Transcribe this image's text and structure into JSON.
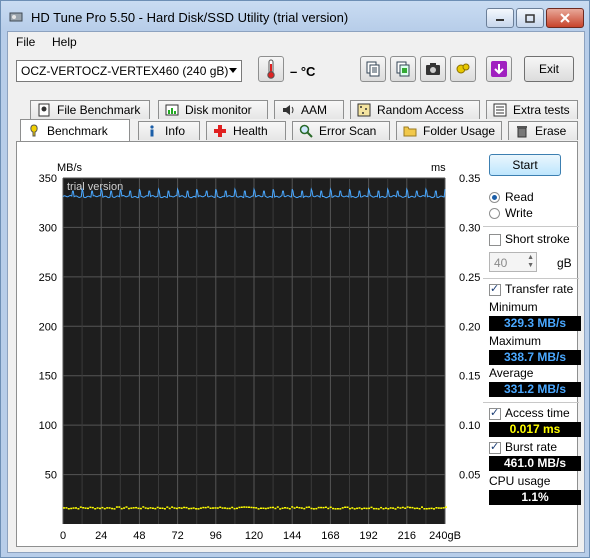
{
  "window": {
    "title": "HD Tune Pro 5.50 - Hard Disk/SSD Utility (trial version)"
  },
  "menu": {
    "file": "File",
    "help": "Help"
  },
  "toolbar": {
    "drive": "OCZ-VERTOCZ-VERTEX460 (240 gB)",
    "temperature": "– °C",
    "exit": "Exit"
  },
  "tabs_top": [
    "File Benchmark",
    "Disk monitor",
    "AAM",
    "Random Access",
    "Extra tests"
  ],
  "tabs_bottom": [
    "Benchmark",
    "Info",
    "Health",
    "Error Scan",
    "Folder Usage",
    "Erase"
  ],
  "controls": {
    "start": "Start",
    "read": "Read",
    "write": "Write",
    "short_stroke": "Short stroke",
    "stroke_value": "40",
    "stroke_unit": "gB",
    "transfer_rate": "Transfer rate",
    "minimum_label": "Minimum",
    "minimum_value": "329.3 MB/s",
    "maximum_label": "Maximum",
    "maximum_value": "338.7 MB/s",
    "average_label": "Average",
    "average_value": "331.2 MB/s",
    "access_time_label": "Access time",
    "access_time_value": "0.017 ms",
    "burst_rate_label": "Burst rate",
    "burst_rate_value": "461.0 MB/s",
    "cpu_usage_label": "CPU usage",
    "cpu_usage_value": "1.1%"
  },
  "colors": {
    "transfer_line": "#4aa8ff",
    "access_points": "#ffff00",
    "plot_background": "#1e1e1e",
    "grid": "#555555"
  },
  "chart_data": {
    "type": "line",
    "watermark": "trial version",
    "y_left_label": "MB/s",
    "y_right_label": "ms",
    "y_left_ticks": [
      "350",
      "300",
      "250",
      "200",
      "150",
      "100",
      "50"
    ],
    "y_right_ticks": [
      "0.35",
      "0.30",
      "0.25",
      "0.20",
      "0.15",
      "0.10",
      "0.05"
    ],
    "x_ticks": [
      "0",
      "24",
      "48",
      "72",
      "96",
      "120",
      "144",
      "168",
      "192",
      "216",
      "240gB"
    ],
    "xlim": [
      0,
      240
    ],
    "ylim_left": [
      0,
      350
    ],
    "ylim_right": [
      0,
      0.35
    ],
    "grid": true,
    "series": [
      {
        "name": "Transfer rate",
        "axis": "left",
        "base": 331.2,
        "min": 329.3,
        "max": 338.7,
        "spike_interval_gb": 6
      },
      {
        "name": "Access time",
        "axis": "right",
        "value": 0.017
      }
    ]
  }
}
